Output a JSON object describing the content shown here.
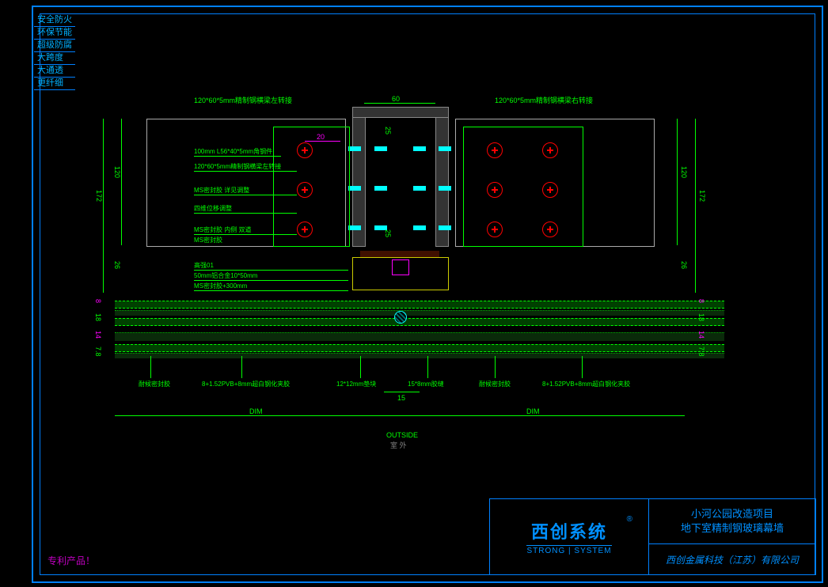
{
  "domain": "Diagram",
  "tags": [
    "安全防火",
    "环保节能",
    "超级防腐",
    "大跨度",
    "大通透",
    "更纤细"
  ],
  "patent_note": "专利产品！",
  "titleblock": {
    "logo_cn": "西创系统",
    "logo_reg": "®",
    "logo_en": "STRONG | SYSTEM",
    "project_line1": "小河公园改造项目",
    "project_line2": "地下室精制钢玻璃幕墙",
    "company": "西创金属科技（江苏）有限公司"
  },
  "dims": {
    "top_left_note": "120*60*5mm精制钢横梁左转接",
    "top_right_note": "120*60*5mm精制钢横梁右转接",
    "top_width": "60",
    "bolt_gap": "20",
    "bolt_pitch_1": "25",
    "bolt_pitch_2": "25",
    "col_h_120_l": "120",
    "col_h_120_r": "120",
    "col_h_172_l": "172",
    "col_h_172_r": "172",
    "gap_26": "26",
    "glass_8_l": "8",
    "glass_8_r": "8",
    "glass_18_l": "18",
    "glass_18_r": "18",
    "glass_14_l": "14",
    "glass_14_r": "14",
    "glass_7_8_l": "7.8",
    "glass_7_8_r": "7.8",
    "btm_joint": "15",
    "dim_generic": "DIM"
  },
  "labels": {
    "outside_en": "OUTSIDE",
    "outside_cn": "室  外",
    "bottom_spec_glass_l": "8+1.52PVB+8mm超白钢化夹胶",
    "bottom_spec_glass_r": "8+1.52PVB+8mm超白钢化夹胶",
    "bottom_spacer": "12*12mm垫块",
    "bottom_sealant": "15*8mm胶缝",
    "bottom_weather": "耐候密封胶",
    "midblk_label": "密封"
  },
  "leaders": {
    "l1": "100mm L56*40*5mm角钢件",
    "l2": "120*60*5mm精制钢横梁左转接",
    "l3": "MS密封胶 详见调整",
    "l4": "四维位移调整",
    "l5": "MS密封胶 内侧 双道",
    "l6": "MS密封胶",
    "r1": "高强01",
    "r2": "50mm铝合金10*50mm",
    "r3": "MS密封胶+300mm"
  }
}
